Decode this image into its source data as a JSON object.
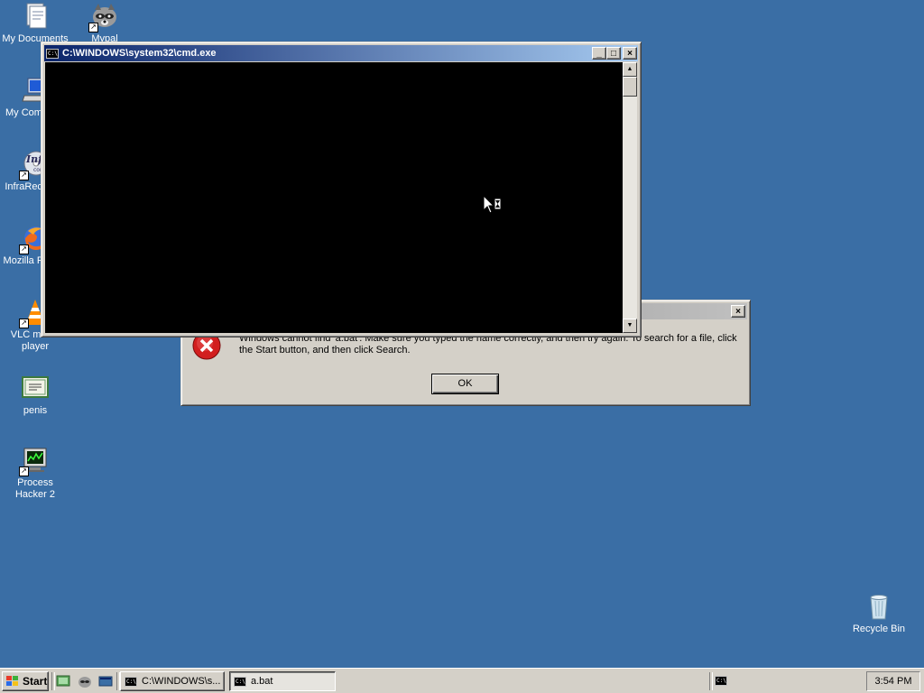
{
  "desktop": {
    "background_color": "#3a6ea5",
    "icons": [
      {
        "label": "My Documents",
        "icon": "documents-icon"
      },
      {
        "label": "Mypal",
        "icon": "mypal-raccoon-icon"
      },
      {
        "label": "My Computer",
        "icon": "computer-icon"
      },
      {
        "label": "InfraRecorder",
        "icon": "infrarecorder-icon"
      },
      {
        "label": "Mozilla Firefox",
        "icon": "firefox-icon"
      },
      {
        "label": "VLC media player",
        "icon": "vlc-icon"
      },
      {
        "label": "penis",
        "icon": "certificate-icon"
      },
      {
        "label": "Process Hacker 2",
        "icon": "process-hacker-icon"
      },
      {
        "label": "Recycle Bin",
        "icon": "recycle-bin-icon"
      }
    ]
  },
  "cmd_window": {
    "title": "C:\\WINDOWS\\system32\\cmd.exe",
    "icon_text": "C:\\",
    "minimize_symbol": "_",
    "maximize_symbol": "□",
    "close_symbol": "×",
    "scroll_up_symbol": "▲",
    "scroll_down_symbol": "▼"
  },
  "error_dialog": {
    "title": "",
    "close_symbol": "×",
    "message": "Windows cannot find 'a.bat'. Make sure you typed the name correctly, and then try again. To search for a file, click the Start button, and then click Search.",
    "ok_label": "OK"
  },
  "taskbar": {
    "start_label": "Start",
    "buttons": [
      {
        "label": "C:\\WINDOWS\\s...",
        "icon": "cmd-icon"
      },
      {
        "label": "a.bat",
        "icon": "cmd-icon"
      }
    ],
    "tray_icon_text": "C:\\",
    "clock": "3:54 PM"
  }
}
